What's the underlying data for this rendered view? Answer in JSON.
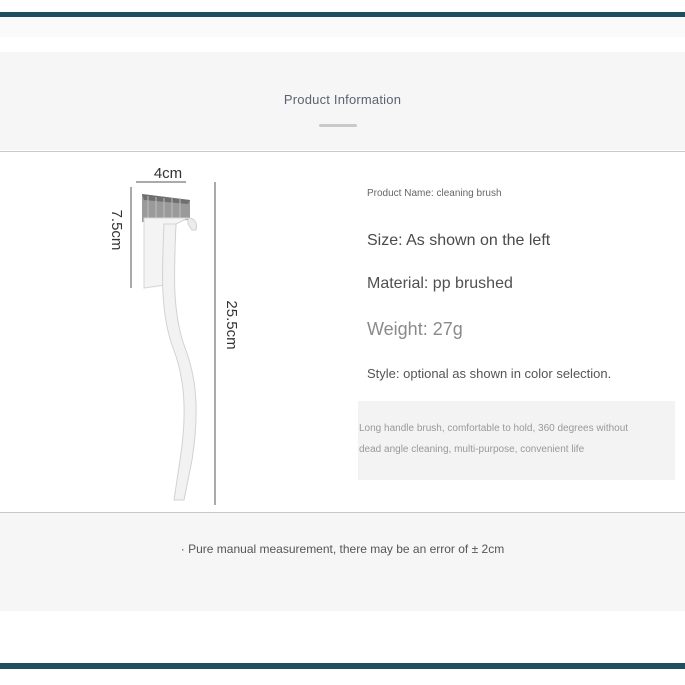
{
  "header": {
    "title": "Product Information"
  },
  "product_image": {
    "dimensions": {
      "width": "4cm",
      "head_height": "7.5cm",
      "total_length": "25.5cm"
    },
    "colors": {
      "brush_body": "#f2f2f2",
      "bristles": "#9a9a9a"
    }
  },
  "specs": {
    "name": "Product Name: cleaning brush",
    "size": "Size: As shown on the left",
    "material": "Material: pp brushed",
    "weight": "Weight: 27g",
    "style": "Style: optional as shown in color selection."
  },
  "description": {
    "line1": "Long handle brush, comfortable to hold, 360 degrees without",
    "line2": "dead angle cleaning, multi-purpose, convenient life"
  },
  "footer": {
    "note": "· Pure manual measurement, there may be an error of ± 2cm"
  },
  "theme": {
    "accent_bar": "#1f4e5f"
  }
}
